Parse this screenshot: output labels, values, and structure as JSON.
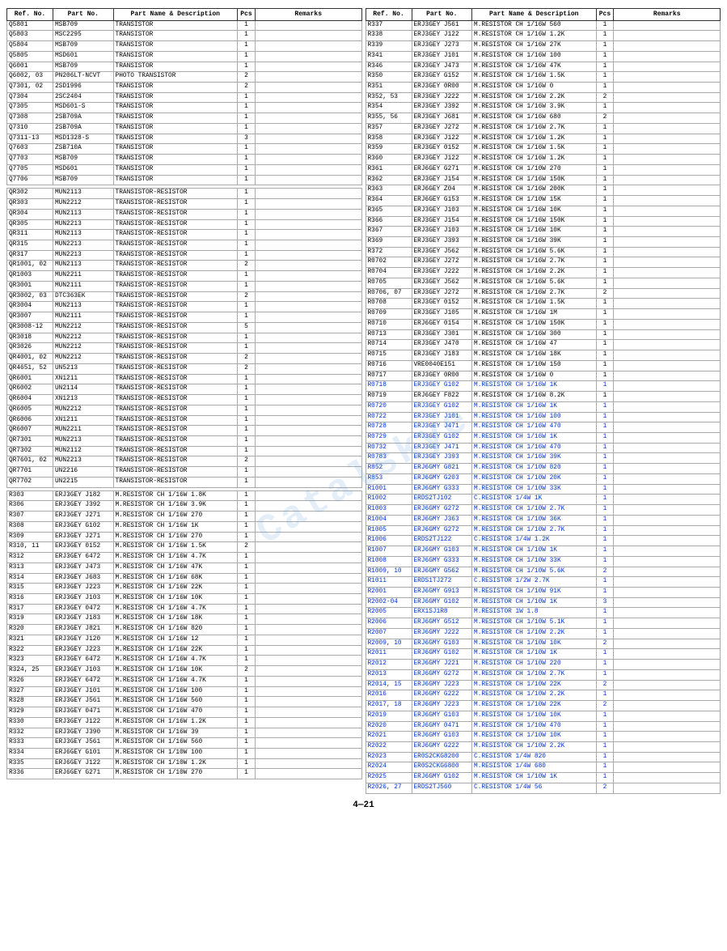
{
  "watermark": "Catalskye",
  "page_number": "4—21",
  "left_table": {
    "headers": [
      "Ref. No.",
      "Part No.",
      "Part Name & Description",
      "Pcs",
      "Remarks"
    ],
    "rows": [
      [
        "Q5801",
        "MSB709",
        "TRANSISTOR",
        "1",
        ""
      ],
      [
        "Q5803",
        "MSC2295",
        "TRANSISTOR",
        "1",
        ""
      ],
      [
        "Q5804",
        "MSB709",
        "TRANSISTOR",
        "1",
        ""
      ],
      [
        "Q5805",
        "MSD601",
        "TRANSISTOR",
        "1",
        ""
      ],
      [
        "Q6001",
        "MSB709",
        "TRANSISTOR",
        "1",
        ""
      ],
      [
        "Q6002, 03",
        "PN206LT-NCVT",
        "PHOTO TRANSISTOR",
        "2",
        ""
      ],
      [
        "Q7301, 02",
        "2SD1996",
        "TRANSISTOR",
        "2",
        ""
      ],
      [
        "Q7304",
        "2SC2404",
        "TRANSISTOR",
        "1",
        ""
      ],
      [
        "Q7305",
        "MSD601-S",
        "TRANSISTOR",
        "1",
        ""
      ],
      [
        "Q7308",
        "2SB709A",
        "TRANSISTOR",
        "1",
        ""
      ],
      [
        "Q7310",
        "2SB709A",
        "TRANSISTOR",
        "1",
        ""
      ],
      [
        "Q7311-13",
        "MSD1328-S",
        "TRANSISTOR",
        "3",
        ""
      ],
      [
        "Q7603",
        "ZSB710A",
        "TRANSISTOR",
        "1",
        ""
      ],
      [
        "Q7703",
        "MSB709",
        "TRANSISTOR",
        "1",
        ""
      ],
      [
        "Q7705",
        "MSD601",
        "TRANSISTOR",
        "1",
        ""
      ],
      [
        "Q7706",
        "MSB709",
        "TRANSISTOR",
        "1",
        ""
      ],
      [
        "",
        "",
        "",
        "",
        ""
      ],
      [
        "QR302",
        "MUN2113",
        "TRANSISTOR-RESISTOR",
        "1",
        ""
      ],
      [
        "QR303",
        "MUN2212",
        "TRANSISTOR-RESISTOR",
        "1",
        ""
      ],
      [
        "QR304",
        "MUN2113",
        "TRANSISTOR-RESISTOR",
        "1",
        ""
      ],
      [
        "QR305",
        "MUN2213",
        "TRANSISTOR-RESISTOR",
        "1",
        ""
      ],
      [
        "QR311",
        "MUN2113",
        "TRANSISTOR-RESISTOR",
        "1",
        ""
      ],
      [
        "QR315",
        "MUN2213",
        "TRANSISTOR-RESISTOR",
        "1",
        ""
      ],
      [
        "QR317",
        "MUN2213",
        "TRANSISTOR-RESISTOR",
        "1",
        ""
      ],
      [
        "QR1001, 02",
        "MUN2113",
        "TRANSISTOR-RESISTOR",
        "2",
        ""
      ],
      [
        "QR1003",
        "MUN2211",
        "TRANSISTOR-RESISTOR",
        "1",
        ""
      ],
      [
        "QR3001",
        "MUN2111",
        "TRANSISTOR-RESISTOR",
        "1",
        ""
      ],
      [
        "QR3002, 03",
        "DTC363EK",
        "TRANSISTOR-RESISTOR",
        "2",
        ""
      ],
      [
        "QR3004",
        "MUN2113",
        "TRANSISTOR-RESISTOR",
        "1",
        ""
      ],
      [
        "QR3007",
        "MUN2111",
        "TRANSISTOR-RESISTOR",
        "1",
        ""
      ],
      [
        "QR3008-12",
        "MUN2212",
        "TRANSISTOR-RESISTOR",
        "5",
        ""
      ],
      [
        "QR3018",
        "MUN2212",
        "TRANSISTOR-RESISTOR",
        "1",
        ""
      ],
      [
        "QR3026",
        "MUN2212",
        "TRANSISTOR-RESISTOR",
        "1",
        ""
      ],
      [
        "QR4001, 02",
        "MUN2212",
        "TRANSISTOR-RESISTOR",
        "2",
        ""
      ],
      [
        "QR4651, 52",
        "UN5213",
        "TRANSISTOR-RESISTOR",
        "2",
        ""
      ],
      [
        "QR6001",
        "XN1211",
        "TRANSISTOR-RESISTOR",
        "1",
        ""
      ],
      [
        "QR6002",
        "UN2114",
        "TRANSISTOR-RESISTOR",
        "1",
        ""
      ],
      [
        "QR6004",
        "XN1213",
        "TRANSISTOR-RESISTOR",
        "1",
        ""
      ],
      [
        "QR6005",
        "MUN2212",
        "TRANSISTOR-RESISTOR",
        "1",
        ""
      ],
      [
        "QR6006",
        "XN1211",
        "TRANSISTOR-RESISTOR",
        "1",
        ""
      ],
      [
        "QR6007",
        "MUN2211",
        "TRANSISTOR-RESISTOR",
        "1",
        ""
      ],
      [
        "QR7301",
        "MUN2213",
        "TRANSISTOR-RESISTOR",
        "1",
        ""
      ],
      [
        "QR7302",
        "MUN2112",
        "TRANSISTOR-RESISTOR",
        "1",
        ""
      ],
      [
        "QR7601, 02",
        "MUN2213",
        "TRANSISTOR-RESISTOR",
        "2",
        ""
      ],
      [
        "QR7701",
        "UN2216",
        "TRANSISTOR-RESISTOR",
        "1",
        ""
      ],
      [
        "QR7702",
        "UN2215",
        "TRANSISTOR-RESISTOR",
        "1",
        ""
      ],
      [
        "",
        "",
        "",
        "",
        ""
      ],
      [
        "R303",
        "ERJ3GEY J182",
        "M.RESISTOR CH 1/16W  1.8K",
        "1",
        ""
      ],
      [
        "R306",
        "ERJ3GEY J392",
        "M.RESISTOR CH 1/16W  3.9K",
        "1",
        ""
      ],
      [
        "R307",
        "ERJ3GEY J271",
        "M.RESISTOR CH 1/16W   270",
        "1",
        ""
      ],
      [
        "R308",
        "ERJ3GEY G102",
        "M.RESISTOR CH 1/16W    1K",
        "1",
        ""
      ],
      [
        "R309",
        "ERJ3GEY J271",
        "M.RESISTOR CH 1/16W   270",
        "1",
        ""
      ],
      [
        "R310, 11",
        "ERJ3GEY 0152",
        "M.RESISTOR CH 1/16W  1.5K",
        "2",
        ""
      ],
      [
        "R312",
        "ERJ3GEY 6472",
        "M.RESISTOR CH 1/16W  4.7K",
        "1",
        ""
      ],
      [
        "R313",
        "ERJ3GEY J473",
        "M.RESISTOR CH 1/16W   47K",
        "1",
        ""
      ],
      [
        "R314",
        "ERJ3GEY J683",
        "M.RESISTOR CH 1/16W   68K",
        "1",
        ""
      ],
      [
        "R315",
        "ERJ3GEY J223",
        "M.RESISTOR CH 1/16W   22K",
        "1",
        ""
      ],
      [
        "R316",
        "ERJ3GEY J103",
        "M.RESISTOR CH 1/16W   10K",
        "1",
        ""
      ],
      [
        "R317",
        "ERJ3GEY 0472",
        "M.RESISTOR CH 1/16W  4.7K",
        "1",
        ""
      ],
      [
        "R319",
        "ERJ3GEY J183",
        "M.RESISTOR CH 1/16W   18K",
        "1",
        ""
      ],
      [
        "R320",
        "ERJ3GEY J821",
        "M.RESISTOR CH 1/16W   820",
        "1",
        ""
      ],
      [
        "R321",
        "ERJ3GEY J120",
        "M.RESISTOR CH 1/16W    12",
        "1",
        ""
      ],
      [
        "R322",
        "ERJ3GEY J223",
        "M.RESISTOR CH 1/16W   22K",
        "1",
        ""
      ],
      [
        "R323",
        "ERJ3GEY 6472",
        "M.RESISTOR CH 1/16W  4.7K",
        "1",
        ""
      ],
      [
        "R324, 25",
        "ERJ3GEY J103",
        "M.RESISTOR CH 1/16W   10K",
        "2",
        ""
      ],
      [
        "R326",
        "ERJ3GEY 6472",
        "M.RESISTOR CH 1/16W  4.7K",
        "1",
        ""
      ],
      [
        "R327",
        "ERJ3GEY J101",
        "M.RESISTOR CH 1/16W   100",
        "1",
        ""
      ],
      [
        "R328",
        "ERJ3GEY J561",
        "M.RESISTOR CH 1/16W   560",
        "1",
        ""
      ],
      [
        "R329",
        "ERJ3GEY 0471",
        "M.RESISTOR CH 1/16W   470",
        "1",
        ""
      ],
      [
        "R330",
        "ERJ3GEY J122",
        "M.RESISTOR CH 1/16W  1.2K",
        "1",
        ""
      ],
      [
        "R332",
        "ERJ3GEY J390",
        "M.RESISTOR CH 1/16W    39",
        "1",
        ""
      ],
      [
        "R333",
        "ERJ3GEY J561",
        "M.RESISTOR CH 1/16W   560",
        "1",
        ""
      ],
      [
        "R334",
        "ERJ6GEY G101",
        "M.RESISTOR CH 1/10W   100",
        "1",
        ""
      ],
      [
        "R335",
        "ERJ6GEY J122",
        "M.RESISTOR CH 1/10W  1.2K",
        "1",
        ""
      ],
      [
        "R336",
        "ERJ6GEY G271",
        "M.RESISTOR CH 1/10W   270",
        "1",
        ""
      ]
    ]
  },
  "right_table": {
    "headers": [
      "Ref. No.",
      "Part No.",
      "Part Name & Description",
      "Pcs",
      "Remarks"
    ],
    "rows": [
      [
        "R337",
        "ERJ3GEY J561",
        "M.RESISTOR CH 1/16W   560",
        "1",
        ""
      ],
      [
        "R338",
        "ERJ3GEY J122",
        "M.RESISTOR CH 1/16W  1.2K",
        "1",
        ""
      ],
      [
        "R339",
        "ERJ3GEY J273",
        "M.RESISTOR CH 1/16W   27K",
        "1",
        ""
      ],
      [
        "R341",
        "ERJ3GEY J101",
        "M.RESISTOR CH 1/16W   100",
        "1",
        ""
      ],
      [
        "R346",
        "ERJ3GEY J473",
        "M.RESISTOR CH 1/16W   47K",
        "1",
        ""
      ],
      [
        "R350",
        "ERJ3GEY G152",
        "M.RESISTOR CH 1/16W  1.5K",
        "1",
        ""
      ],
      [
        "R351",
        "ERJ3GEY 0R00",
        "M.RESISTOR CH 1/16W     0",
        "1",
        ""
      ],
      [
        "R352, 53",
        "ERJ3GEY J222",
        "M.RESISTOR CH 1/16W  2.2K",
        "2",
        ""
      ],
      [
        "R354",
        "ERJ3GEY J392",
        "M.RESISTOR CH 1/16W  3.9K",
        "1",
        ""
      ],
      [
        "R355, 56",
        "ERJ3GEY J681",
        "M.RESISTOR CH 1/16W   680",
        "2",
        ""
      ],
      [
        "R357",
        "ERJ3GEY J272",
        "M.RESISTOR CH 1/16W  2.7K",
        "1",
        ""
      ],
      [
        "R358",
        "ERJ3GEY J122",
        "M.RESISTOR CH 1/16W  1.2K",
        "1",
        ""
      ],
      [
        "R359",
        "ERJ3GEY 0152",
        "M.RESISTOR CH 1/16W  1.5K",
        "1",
        ""
      ],
      [
        "R360",
        "ERJ3GEY J122",
        "M.RESISTOR CH 1/16W  1.2K",
        "1",
        ""
      ],
      [
        "R361",
        "ERJ6GEY G271",
        "M.RESISTOR CH 1/10W   270",
        "1",
        ""
      ],
      [
        "R362",
        "ERJ3GEY J154",
        "M.RESISTOR CH 1/16W  150K",
        "1",
        ""
      ],
      [
        "R363",
        "ERJ6GEY Z04",
        "M.RESISTOR CH 1/16W  200K",
        "1",
        ""
      ],
      [
        "R364",
        "ERJ6GEY G153",
        "M.RESISTOR CH 1/10W   15K",
        "1",
        ""
      ],
      [
        "R365",
        "ERJ3GEY J103",
        "M.RESISTOR CH 1/16W   10K",
        "1",
        ""
      ],
      [
        "R366",
        "ERJ3GEY J154",
        "M.RESISTOR CH 1/16W  150K",
        "1",
        ""
      ],
      [
        "R367",
        "ERJ3GEY J103",
        "M.RESISTOR CH 1/16W   10K",
        "1",
        ""
      ],
      [
        "R369",
        "ERJ3GEY J393",
        "M.RESISTOR CH 1/16W   39K",
        "1",
        ""
      ],
      [
        "R372",
        "ERJ3GEY J562",
        "M.RESISTOR CH 1/16W  5.6K",
        "1",
        ""
      ],
      [
        "R0702",
        "ERJ3GEY J272",
        "M.RESISTOR CH 1/16W  2.7K",
        "1",
        ""
      ],
      [
        "R0704",
        "ERJ3GEY J222",
        "M.RESISTOR CH 1/16W  2.2K",
        "1",
        ""
      ],
      [
        "R0705",
        "ERJ3GEY J562",
        "M.RESISTOR CH 1/16W  5.6K",
        "1",
        ""
      ],
      [
        "R0706, 07",
        "ERJ3GEY J272",
        "M.RESISTOR CH 1/16W  2.7K",
        "2",
        ""
      ],
      [
        "R0708",
        "ERJ3GEY 0152",
        "M.RESISTOR CH 1/16W  1.5K",
        "1",
        ""
      ],
      [
        "R0709",
        "ERJ3GEY J105",
        "M.RESISTOR CH 1/16W    1M",
        "1",
        ""
      ],
      [
        "R0710",
        "ERJ6GEY 0154",
        "M.RESISTOR CH 1/10W  150K",
        "1",
        ""
      ],
      [
        "R0713",
        "ERJ3GEY J301",
        "M.RESISTOR CH 1/16W   300",
        "1",
        ""
      ],
      [
        "R0714",
        "ERJ3GEY J470",
        "M.RESISTOR CH 1/16W    47",
        "1",
        ""
      ],
      [
        "R0715",
        "ERJ3GEY J183",
        "M.RESISTOR CH 1/16W   18K",
        "1",
        ""
      ],
      [
        "R0716",
        "VRE0040E151",
        "M.RESISTOR CH 1/10W   150",
        "1",
        ""
      ],
      [
        "R0717",
        "ERJ3GEY 0R00",
        "M.RESISTOR CH 1/16W     0",
        "1",
        ""
      ],
      [
        "R0718",
        "ERJ3GEY G102",
        "M.RESISTOR CH 1/16W    1K",
        "1",
        ""
      ],
      [
        "R0719",
        "ERJ6GEY F822",
        "M.RESISTOR CH 1/16W  8.2K",
        "1",
        ""
      ],
      [
        "R0720",
        "ERJ3GEY G102",
        "M.RESISTOR CH 1/16W    1K",
        "1",
        ""
      ],
      [
        "R0722",
        "ERJ3GEY J101",
        "M.RESISTOR CH 1/16W   100",
        "1",
        ""
      ],
      [
        "R0728",
        "ERJ3GEY J471",
        "M.RESISTOR CH 1/16W   470",
        "1",
        ""
      ],
      [
        "R0729",
        "ERJ3GEY G102",
        "M.RESISTOR CH 1/16W    1K",
        "1",
        ""
      ],
      [
        "R0732",
        "ERJ3GEY J471",
        "M.RESISTOR CH 1/16W   470",
        "1",
        ""
      ],
      [
        "R0783",
        "ERJ3GEY J393",
        "M.RESISTOR CH 1/16W   39K",
        "1",
        ""
      ],
      [
        "R852",
        "ERJ6GMY G821",
        "M.RESISTOR CH 1/10W   820",
        "1",
        ""
      ],
      [
        "R853",
        "ERJ6GMY G203",
        "M.RESISTOR CH 1/10W   20K",
        "1",
        ""
      ],
      [
        "R1001",
        "ERJ6GMY G333",
        "M.RESISTOR CH 1/10W   33K",
        "1",
        ""
      ],
      [
        "R1002",
        "ERDS2TJ102",
        "C.RESISTOR   1/4W    1K",
        "1",
        ""
      ],
      [
        "R1003",
        "ERJ6GMY G272",
        "M.RESISTOR CH 1/10W  2.7K",
        "1",
        ""
      ],
      [
        "R1004",
        "ERJ6GMY J363",
        "M.RESISTOR CH 1/10W   36K",
        "1",
        ""
      ],
      [
        "R1005",
        "ERJ6GMY G272",
        "M.RESISTOR CH 1/10W  2.7K",
        "1",
        ""
      ],
      [
        "R1006",
        "ERDS2TJ122",
        "C.RESISTOR   1/4W  1.2K",
        "1",
        ""
      ],
      [
        "R1007",
        "ERJ6GMY G103",
        "M.RESISTOR CH 1/10W    1K",
        "1",
        ""
      ],
      [
        "R1008",
        "ERJ6GMY G333",
        "M.RESISTOR CH 1/10W   33K",
        "1",
        ""
      ],
      [
        "R1009, 10",
        "ERJ6GMY G562",
        "M.RESISTOR CH 1/10W  5.6K",
        "2",
        ""
      ],
      [
        "R1011",
        "ERDS1TJ272",
        "C.RESISTOR   1/2W  2.7K",
        "1",
        ""
      ],
      [
        "R2001",
        "ERJ6GMY G913",
        "M.RESISTOR CH 1/10W   91K",
        "1",
        ""
      ],
      [
        "R2002-04",
        "ERJ6GMY G102",
        "M.RESISTOR CH 1/10W    1K",
        "3",
        ""
      ],
      [
        "R2005",
        "ERX1SJ1R8",
        "M.RESISTOR    1W   1.8",
        "1",
        ""
      ],
      [
        "R2006",
        "ERJ6GMY G512",
        "M.RESISTOR CH 1/10W  5.1K",
        "1",
        ""
      ],
      [
        "R2007",
        "ERJ6GMY J222",
        "M.RESISTOR CH 1/10W  2.2K",
        "1",
        ""
      ],
      [
        "R2009, 10",
        "ERJ6GMY G103",
        "M.RESISTOR CH 1/10W   10K",
        "2",
        ""
      ],
      [
        "R2011",
        "ERJ6GMY G102",
        "M.RESISTOR CH 1/10W    1K",
        "1",
        ""
      ],
      [
        "R2012",
        "ERJ6GMY J221",
        "M.RESISTOR CH 1/10W   220",
        "1",
        ""
      ],
      [
        "R2013",
        "ERJ6GMY G272",
        "M.RESISTOR CH 1/10W  2.7K",
        "1",
        ""
      ],
      [
        "R2014, 15",
        "ERJ6GMY J223",
        "M.RESISTOR CH 1/10W   22K",
        "2",
        ""
      ],
      [
        "R2016",
        "ERJ6GMY G222",
        "M.RESISTOR CH 1/10W  2.2K",
        "1",
        ""
      ],
      [
        "R2017, 18",
        "ERJ6GMY J223",
        "M.RESISTOR CH 1/10W   22K",
        "2",
        ""
      ],
      [
        "R2019",
        "ERJ6GMY G103",
        "M.RESISTOR CH 1/10W   10K",
        "1",
        ""
      ],
      [
        "R2020",
        "ERJ6GMY 0471",
        "M.RESISTOR CH 1/10W   470",
        "1",
        ""
      ],
      [
        "R2021",
        "ERJ6GMY G103",
        "M.RESISTOR CH 1/10W   10K",
        "1",
        ""
      ],
      [
        "R2022",
        "ERJ6GMY G222",
        "M.RESISTOR CH 1/10W  2.2K",
        "1",
        ""
      ],
      [
        "R2023",
        "ER0S2CKG8200",
        "C.RESISTOR   1/4W   820",
        "1",
        ""
      ],
      [
        "R2024",
        "ER0S2CKG6800",
        "M.RESISTOR   1/4W   680",
        "1",
        ""
      ],
      [
        "R2025",
        "ERJ6GMY G102",
        "M.RESISTOR CH 1/10W    1K",
        "1",
        ""
      ],
      [
        "R2026, 27",
        "ERDS2TJ560",
        "C.RESISTOR   1/4W    56",
        "2",
        ""
      ]
    ]
  }
}
